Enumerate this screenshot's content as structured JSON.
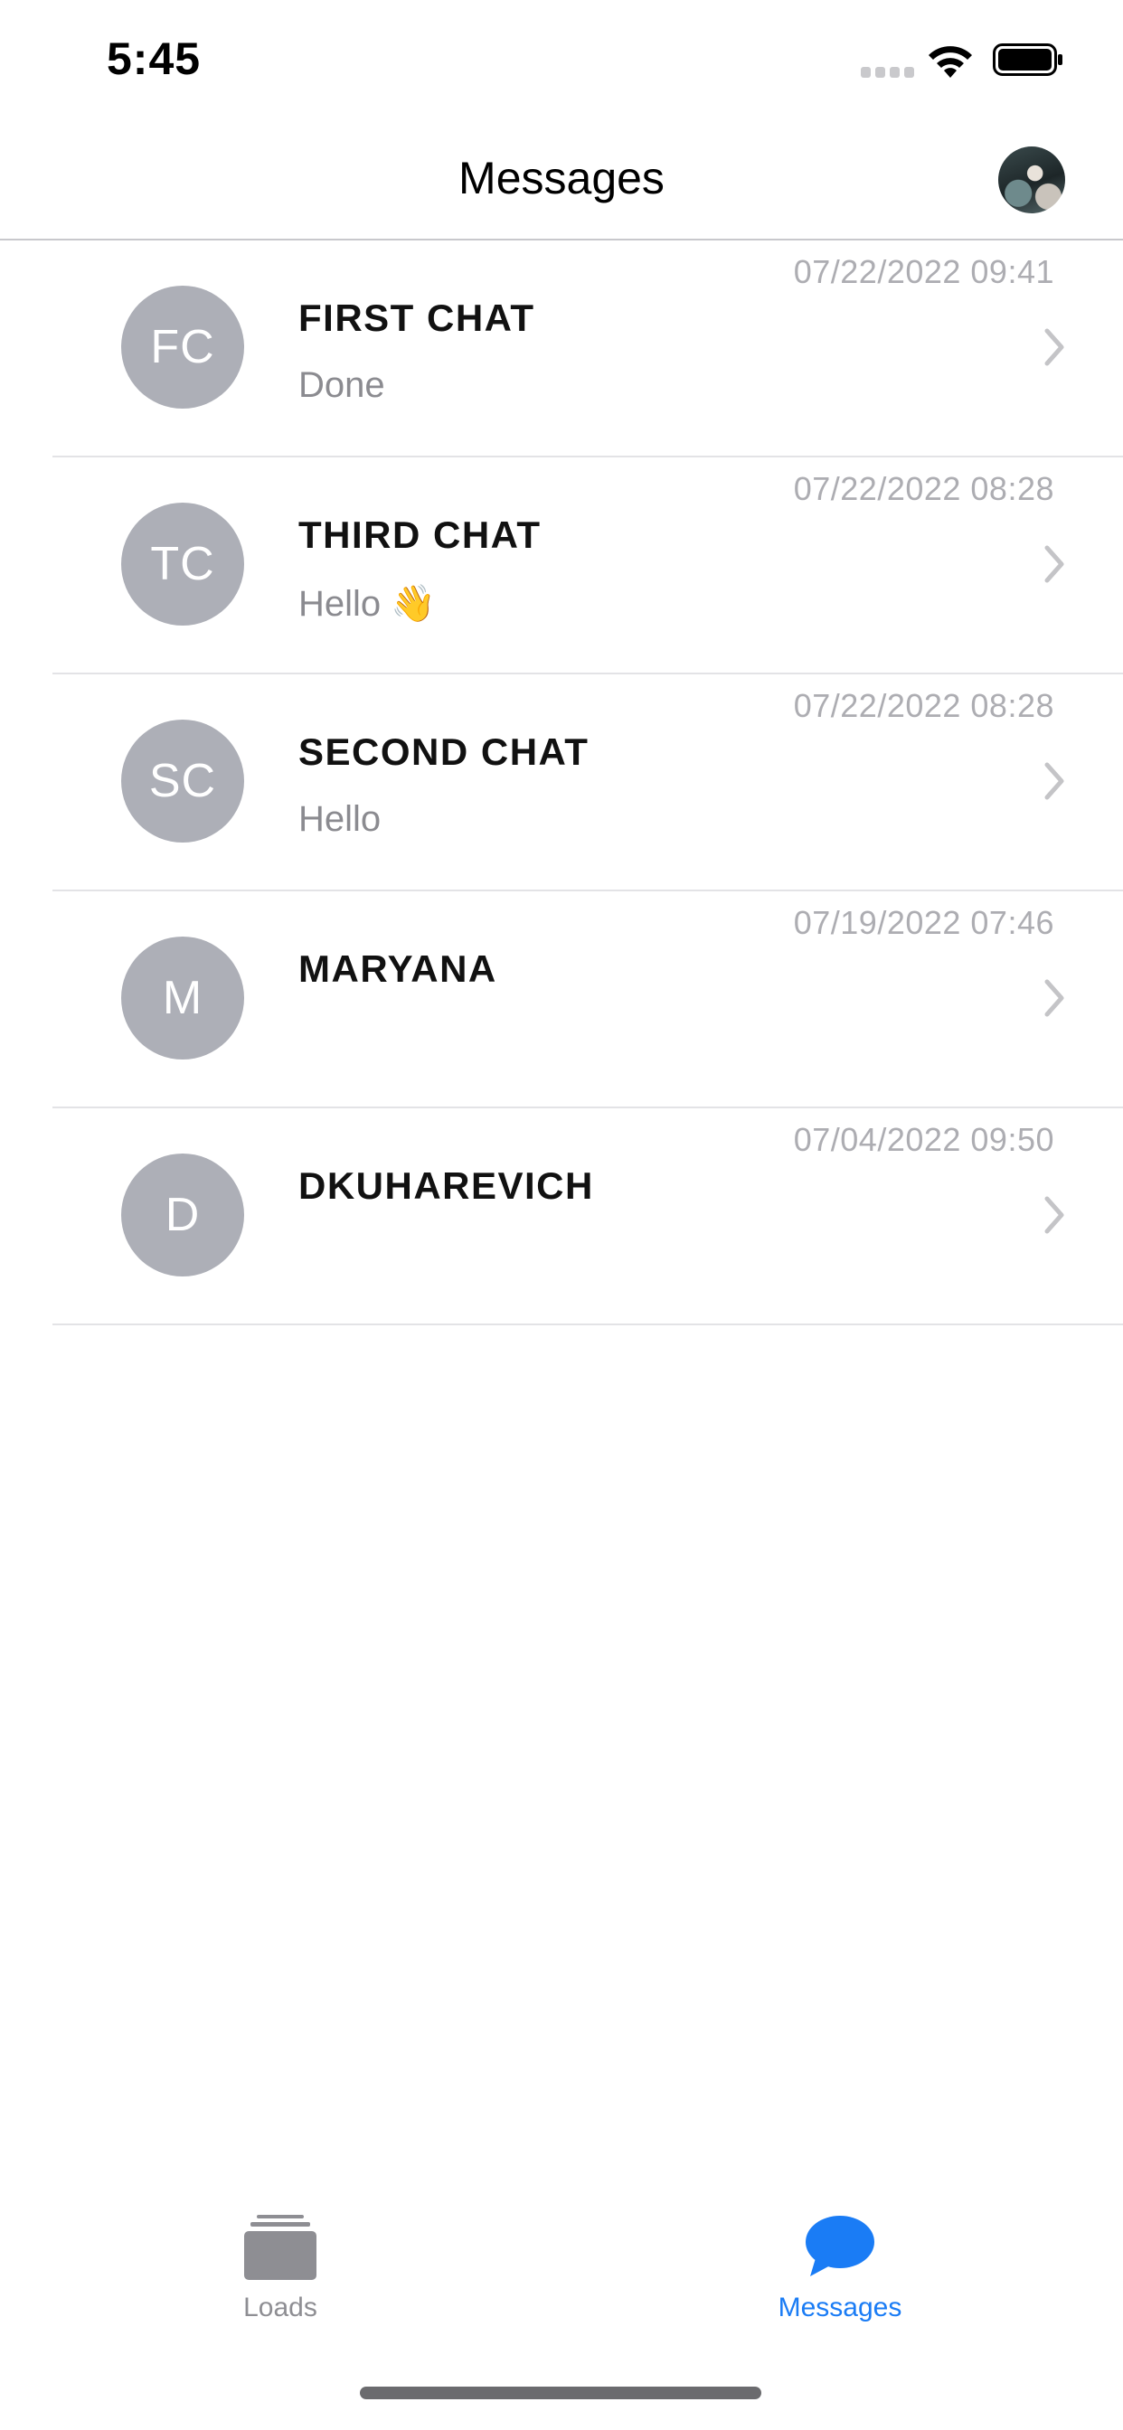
{
  "status_bar": {
    "time": "5:45"
  },
  "nav": {
    "title": "Messages"
  },
  "chats": [
    {
      "initials": "FC",
      "name": "FIRST CHAT",
      "preview": "Done",
      "timestamp": "07/22/2022 09:41"
    },
    {
      "initials": "TC",
      "name": "THIRD CHAT",
      "preview": "Hello 👋",
      "timestamp": "07/22/2022 08:28"
    },
    {
      "initials": "SC",
      "name": "SECOND CHAT",
      "preview": "Hello",
      "timestamp": "07/22/2022 08:28"
    },
    {
      "initials": "M",
      "name": "MARYANA",
      "preview": "",
      "timestamp": "07/19/2022 07:46"
    },
    {
      "initials": "D",
      "name": "DKUHAREVICH",
      "preview": "",
      "timestamp": "07/04/2022 09:50"
    }
  ],
  "tab_bar": {
    "tabs": [
      {
        "label": "Loads",
        "icon": "stacked-cards-icon",
        "selected": false
      },
      {
        "label": "Messages",
        "icon": "chat-bubble-icon",
        "selected": true
      }
    ]
  },
  "colors": {
    "accent": "#1a7cf5",
    "avatar_bg": "#adafb7",
    "secondary_text": "#8b8b90",
    "timestamp_text": "#adadb2"
  }
}
